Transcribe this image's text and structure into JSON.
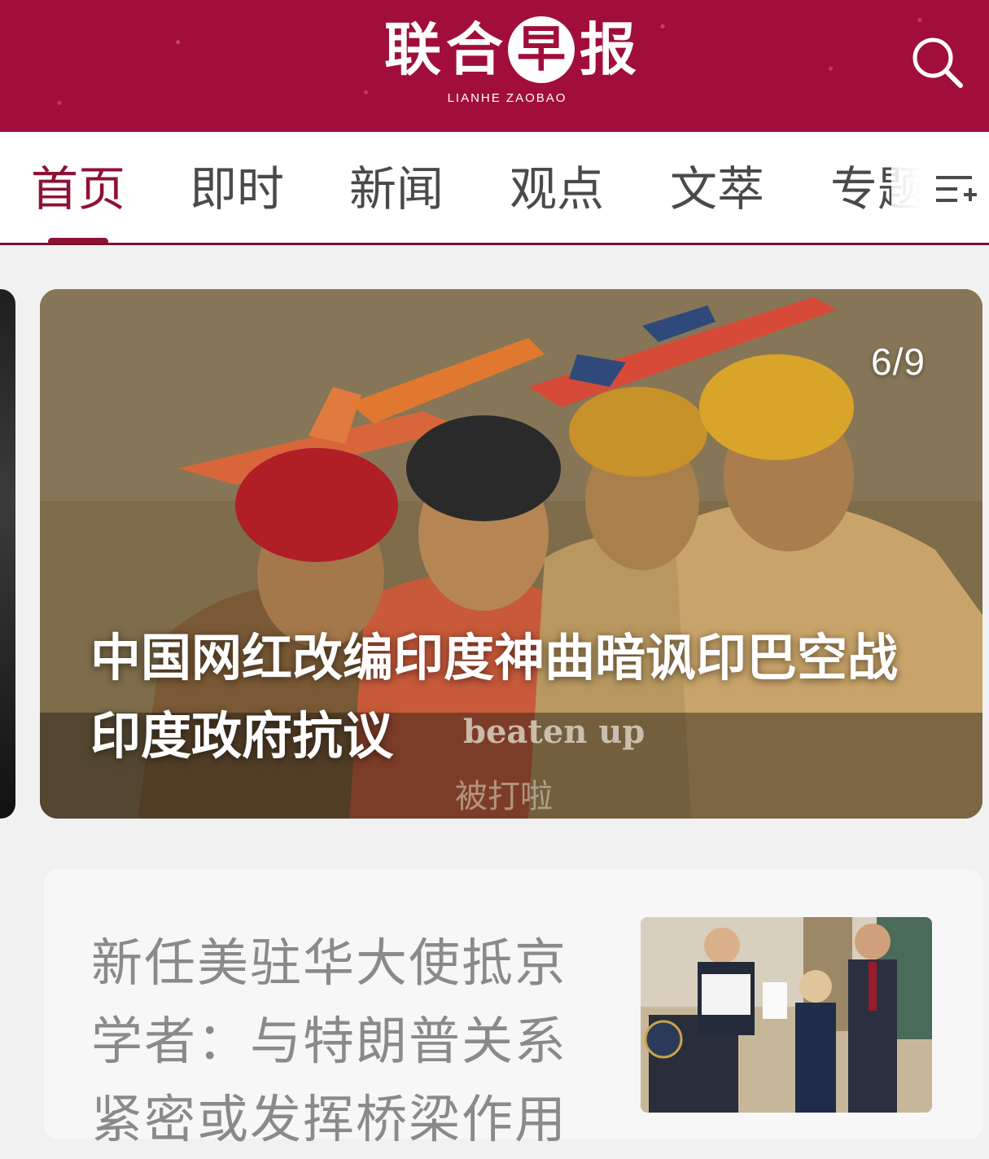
{
  "header": {
    "logo_chars": [
      "联",
      "合",
      "早",
      "报"
    ],
    "logo_en": "LIANHE ZAOBAO",
    "brand_color": "#a10e3a",
    "search_icon": "search-icon"
  },
  "tabs": {
    "items": [
      "首页",
      "即时",
      "新闻",
      "观点",
      "文萃",
      "专题"
    ],
    "active": "首页",
    "menu_icon": "add-list-icon"
  },
  "carousel": {
    "counter": "6/9",
    "title": "中国网红改编印度神曲暗讽印巴空战 印度政府抗议",
    "image_caption_en": "beaten up",
    "image_caption_cn": "被打啦"
  },
  "article": {
    "title": "新任美驻华大使抵京 学者：与特朗普关系紧密或发挥桥梁作用"
  }
}
